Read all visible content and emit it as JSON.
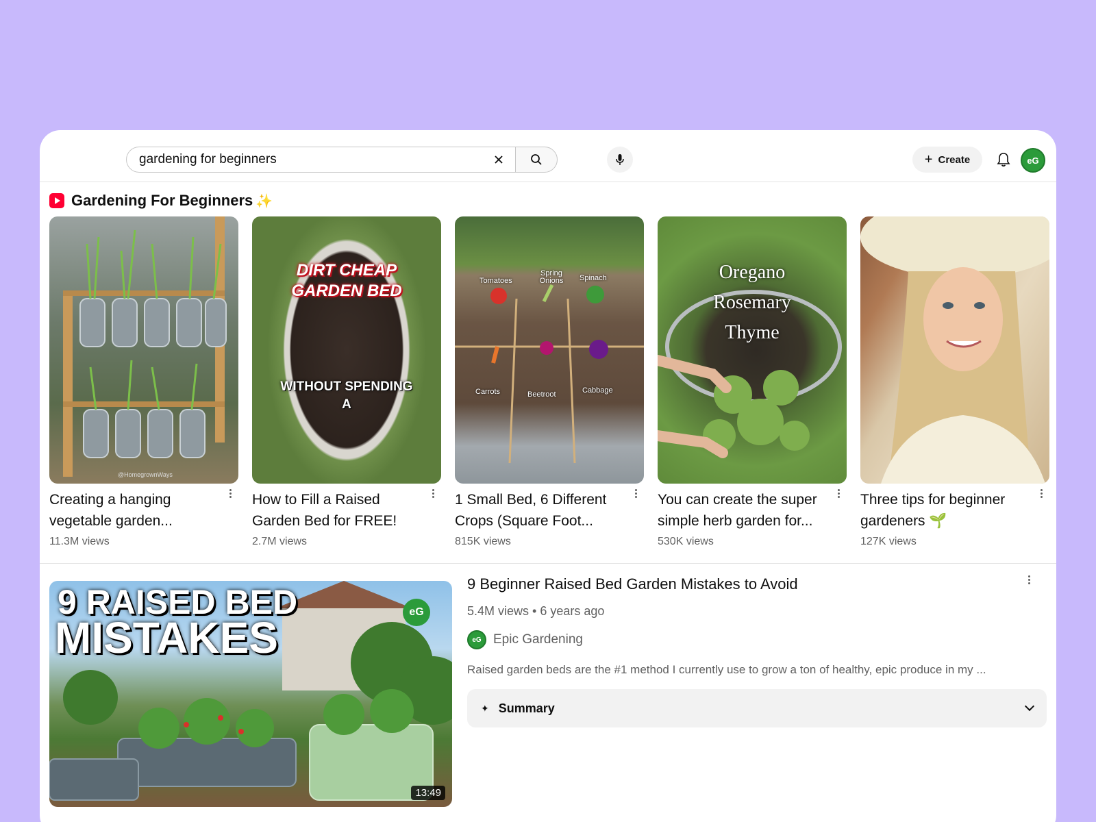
{
  "search": {
    "query": "gardening for beginners",
    "clear_icon": "close-icon",
    "search_icon": "search-icon",
    "mic_icon": "mic-icon"
  },
  "header": {
    "create_label": "Create",
    "avatar_initials": "eG"
  },
  "shelf": {
    "title": "Gardening For Beginners",
    "sparkle": "✨",
    "items": [
      {
        "title": "Creating a hanging vegetable garden...",
        "views": "11.3M views",
        "watermark": "@HomegrownWays"
      },
      {
        "title": "How to Fill a Raised Garden Bed for FREE!",
        "views": "2.7M views",
        "overlay_line1": "DIRT CHEAP",
        "overlay_line2": "GARDEN BED",
        "overlay_line3": "WITHOUT SPENDING",
        "overlay_line4": "A"
      },
      {
        "title": "1 Small Bed, 6 Different Crops (Square Foot...",
        "views": "815K views",
        "labels": [
          "Tomatoes",
          "Spring Onions",
          "Spinach",
          "Carrots",
          "Beetroot",
          "Cabbage"
        ]
      },
      {
        "title": "You can create the super simple herb garden for...",
        "views": "530K views",
        "overlay_line1": "Oregano",
        "overlay_line2": "Rosemary",
        "overlay_line3": "Thyme"
      },
      {
        "title": "Three tips for beginner gardeners 🌱",
        "views": "127K views"
      }
    ]
  },
  "video": {
    "title": "9 Beginner Raised Bed Garden Mistakes to Avoid",
    "meta": "5.4M views • 6 years ago",
    "channel": "Epic Gardening",
    "channel_initials": "eG",
    "description": "Raised garden beds are the #1 method I currently use to grow a ton of healthy, epic produce in my ...",
    "duration": "13:49",
    "thumb_line1": "9 RAISED BED",
    "thumb_line2": "MISTAKES",
    "thumb_badge": "eG"
  },
  "summary": {
    "label": "Summary",
    "spark": "✦"
  }
}
